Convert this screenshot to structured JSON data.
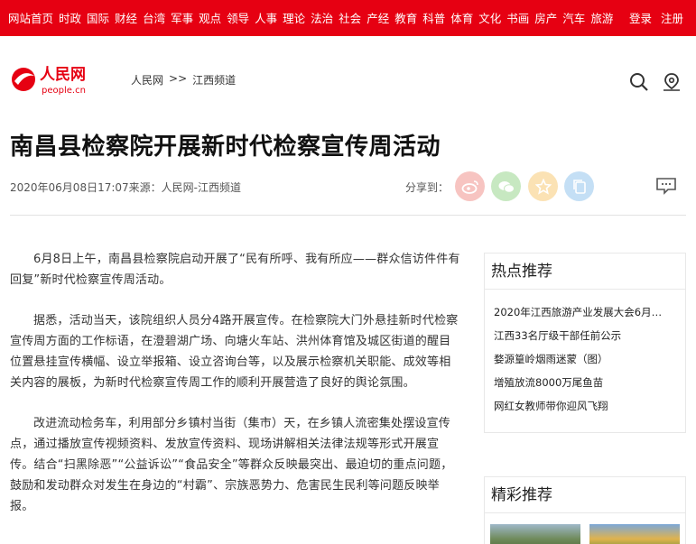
{
  "topnav": {
    "links": [
      "网站首页",
      "时政",
      "国际",
      "财经",
      "台湾",
      "军事",
      "观点",
      "领导",
      "人事",
      "理论",
      "法治",
      "社会",
      "产经",
      "教育",
      "科普",
      "体育",
      "文化",
      "书画",
      "房产",
      "汽车",
      "旅游"
    ],
    "login": "登录",
    "register": "注册"
  },
  "logo": {
    "cn": "人民网",
    "en": "people.cn"
  },
  "breadcrumb": {
    "home": "人民网",
    "sep": ">>",
    "channel": "江西频道"
  },
  "article": {
    "title": "南昌县检察院开展新时代检察宣传周活动",
    "meta": "2020年06月08日17:07来源：人民网-江西频道",
    "share_label": "分享到：",
    "paragraphs": [
      "6月8日上午，南昌县检察院启动开展了“民有所呼、我有所应——群众信访件件有回复”新时代检察宣传周活动。",
      "据悉，活动当天，该院组织人员分4路开展宣传。在检察院大门外悬挂新时代检察宣传周方面的工作标语，在澄碧湖广场、向塘火车站、洪州体育馆及城区街道的醒目位置悬挂宣传横幅、设立举报箱、设立咨询台等，以及展示检察机关职能、成效等相关内容的展板，为新时代检察宣传周工作的顺利开展营造了良好的舆论氛围。",
      "改进流动检务车，利用部分乡镇村当街（集市）天，在乡镇人流密集处摆设宣传点，通过播放宣传视频资料、发放宣传资料、现场讲解相关法律法规等形式开展宣传。结合“扫黑除恶”“公益诉讼”“食品安全”等群众反映最突出、最迫切的重点问题，鼓励和发动群众对发生在身边的“村霸”、宗族恶势力、危害民生民利等问题反映举报。"
    ]
  },
  "sidebar": {
    "hot_title": "热点推荐",
    "hot_items": [
      "2020年江西旅游产业发展大会6月…",
      "江西33名厅级干部任前公示",
      "婺源篁岭烟雨迷蒙（图）",
      "增殖放流8000万尾鱼苗",
      "网红女教师带你迎风飞翔"
    ],
    "featured_title": "精彩推荐"
  },
  "colors": {
    "brand_red": "#e60012"
  }
}
